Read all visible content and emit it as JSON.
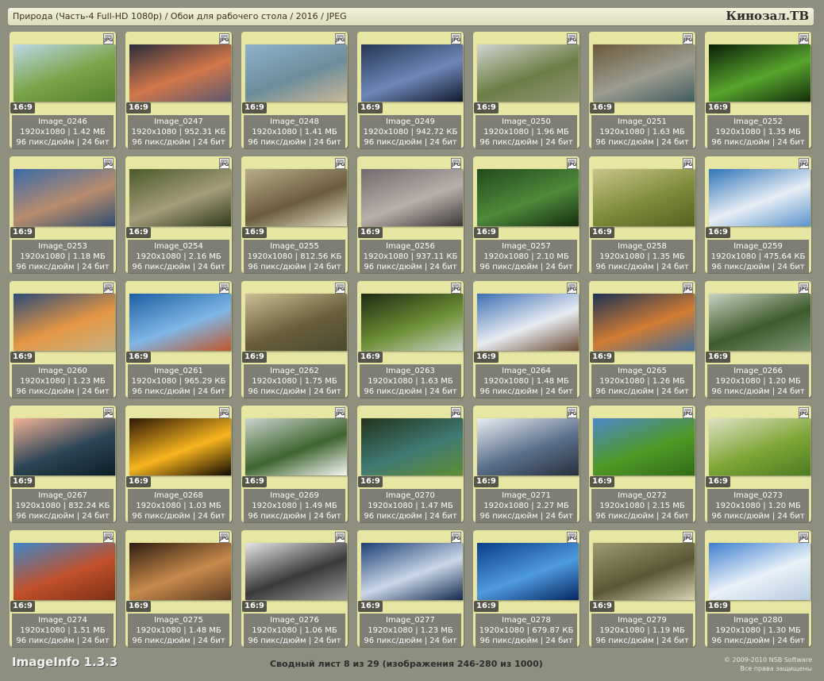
{
  "header": {
    "title": "Природа (Часть-4 Full-HD 1080p) / Обои для рабочего стола / 2016 / JPEG",
    "brand": "Кинозал.ТВ"
  },
  "tile_labels": {
    "format_badge": "JPG",
    "aspect": "16:9"
  },
  "images": [
    {
      "name": "Image_0246",
      "dims": "1920x1080 | 1.42 МБ",
      "meta": "96 пикс/дюйм | 24 бит",
      "colors": [
        "#bcd7e6",
        "#7aa346",
        "#56802e"
      ]
    },
    {
      "name": "Image_0247",
      "dims": "1920x1080 | 952.31 КБ",
      "meta": "96 пикс/дюйм | 24 бит",
      "colors": [
        "#2b2c3b",
        "#d2774a",
        "#5c5870"
      ]
    },
    {
      "name": "Image_0248",
      "dims": "1920x1080 | 1.41 МБ",
      "meta": "96 пикс/дюйм | 24 бит",
      "colors": [
        "#8fb2cc",
        "#6d8d9b",
        "#c9b89a"
      ]
    },
    {
      "name": "Image_0249",
      "dims": "1920x1080 | 942.72 КБ",
      "meta": "96 пикс/дюйм | 24 бит",
      "colors": [
        "#233654",
        "#6f87b8",
        "#101a2e"
      ]
    },
    {
      "name": "Image_0250",
      "dims": "1920x1080 | 1.96 МБ",
      "meta": "96 пикс/дюйм | 24 бит",
      "colors": [
        "#d0d4cf",
        "#6d7e45",
        "#8e9473"
      ]
    },
    {
      "name": "Image_0251",
      "dims": "1920x1080 | 1.63 МБ",
      "meta": "96 пикс/дюйм | 24 бит",
      "colors": [
        "#6b5a3c",
        "#9c9c8f",
        "#415c60"
      ]
    },
    {
      "name": "Image_0252",
      "dims": "1920x1080 | 1.35 МБ",
      "meta": "96 пикс/дюйм | 24 бит",
      "colors": [
        "#0c1e08",
        "#56a52d",
        "#142d0b"
      ]
    },
    {
      "name": "Image_0253",
      "dims": "1920x1080 | 1.18 МБ",
      "meta": "96 пикс/дюйм | 24 бит",
      "colors": [
        "#3a6aa8",
        "#b98c6d",
        "#2e4d70"
      ]
    },
    {
      "name": "Image_0254",
      "dims": "1920x1080 | 2.16 МБ",
      "meta": "96 пикс/дюйм | 24 бит",
      "colors": [
        "#4b5a2a",
        "#a59c7a",
        "#2f3a1c"
      ]
    },
    {
      "name": "Image_0255",
      "dims": "1920x1080 | 812.56 КБ",
      "meta": "96 пикс/дюйм | 24 бит",
      "colors": [
        "#b8ad8a",
        "#6b5c3e",
        "#e3dcc2"
      ]
    },
    {
      "name": "Image_0256",
      "dims": "1920x1080 | 937.11 КБ",
      "meta": "96 пикс/дюйм | 24 бит",
      "colors": [
        "#716a6c",
        "#b9b0aa",
        "#3c3838"
      ]
    },
    {
      "name": "Image_0257",
      "dims": "1920x1080 | 2.10 МБ",
      "meta": "96 пикс/дюйм | 24 бит",
      "colors": [
        "#234a1d",
        "#4e8a3a",
        "#152e10"
      ]
    },
    {
      "name": "Image_0258",
      "dims": "1920x1080 | 1.35 МБ",
      "meta": "96 пикс/дюйм | 24 бит",
      "colors": [
        "#c9c48a",
        "#7e8b3a",
        "#556122"
      ]
    },
    {
      "name": "Image_0259",
      "dims": "1920x1080 | 475.64 КБ",
      "meta": "96 пикс/дюйм | 24 бит",
      "colors": [
        "#2f74b8",
        "#e8eef5",
        "#5a94cc"
      ]
    },
    {
      "name": "Image_0260",
      "dims": "1920x1080 | 1.23 МБ",
      "meta": "96 пикс/дюйм | 24 бит",
      "colors": [
        "#2c4a78",
        "#e49643",
        "#c7b284"
      ]
    },
    {
      "name": "Image_0261",
      "dims": "1920x1080 | 965.29 КБ",
      "meta": "96 пикс/дюйм | 24 бит",
      "colors": [
        "#1d5ea4",
        "#7fb6e6",
        "#c0562a"
      ]
    },
    {
      "name": "Image_0262",
      "dims": "1920x1080 | 1.75 МБ",
      "meta": "96 пикс/дюйм | 24 бит",
      "colors": [
        "#cbbf94",
        "#6a5e3c",
        "#4a4a30"
      ]
    },
    {
      "name": "Image_0263",
      "dims": "1920x1080 | 1.63 МБ",
      "meta": "96 пикс/дюйм | 24 бит",
      "colors": [
        "#1d2b14",
        "#6c8f34",
        "#c6d4c8"
      ]
    },
    {
      "name": "Image_0264",
      "dims": "1920x1080 | 1.48 МБ",
      "meta": "96 пикс/дюйм | 24 бит",
      "colors": [
        "#3c6fb3",
        "#e8ecf2",
        "#6b4a33"
      ]
    },
    {
      "name": "Image_0265",
      "dims": "1920x1080 | 1.26 МБ",
      "meta": "96 пикс/дюйм | 24 бит",
      "colors": [
        "#1c3155",
        "#d27c33",
        "#3e6e9e"
      ]
    },
    {
      "name": "Image_0266",
      "dims": "1920x1080 | 1.20 МБ",
      "meta": "96 пикс/дюйм | 24 бит",
      "colors": [
        "#c8d2c2",
        "#3d5a2c",
        "#7f9677"
      ]
    },
    {
      "name": "Image_0267",
      "dims": "1920x1080 | 832.24 КБ",
      "meta": "96 пикс/дюйм | 24 бит",
      "colors": [
        "#f3b399",
        "#2c4555",
        "#0e1d28"
      ]
    },
    {
      "name": "Image_0268",
      "dims": "1920x1080 | 1.03 МБ",
      "meta": "96 пикс/дюйм | 24 бит",
      "colors": [
        "#2d1806",
        "#f7b51e",
        "#120a03"
      ]
    },
    {
      "name": "Image_0269",
      "dims": "1920x1080 | 1.49 МБ",
      "meta": "96 пикс/дюйм | 24 бит",
      "colors": [
        "#c9d4cd",
        "#3f6530",
        "#f4f7f4"
      ]
    },
    {
      "name": "Image_0270",
      "dims": "1920x1080 | 1.47 МБ",
      "meta": "96 пикс/дюйм | 24 бит",
      "colors": [
        "#23331b",
        "#3f7a74",
        "#5e8e33"
      ]
    },
    {
      "name": "Image_0271",
      "dims": "1920x1080 | 2.27 МБ",
      "meta": "96 пикс/дюйм | 24 бит",
      "colors": [
        "#e8edf2",
        "#5a6f8a",
        "#27303d"
      ]
    },
    {
      "name": "Image_0272",
      "dims": "1920x1080 | 2.15 МБ",
      "meta": "96 пикс/дюйм | 24 бит",
      "colors": [
        "#4d86c9",
        "#4f9a26",
        "#2f6c16"
      ]
    },
    {
      "name": "Image_0273",
      "dims": "1920x1080 | 1.20 МБ",
      "meta": "96 пикс/дюйм | 24 бит",
      "colors": [
        "#dfe2c4",
        "#7ea637",
        "#4d7a1f"
      ]
    },
    {
      "name": "Image_0274",
      "dims": "1920x1080 | 1.51 МБ",
      "meta": "96 пикс/дюйм | 24 бит",
      "colors": [
        "#3f87c8",
        "#c2502a",
        "#7a2f18"
      ]
    },
    {
      "name": "Image_0275",
      "dims": "1920x1080 | 1.48 МБ",
      "meta": "96 пикс/дюйм | 24 бит",
      "colors": [
        "#2e1d10",
        "#c88a4b",
        "#5b3a22"
      ]
    },
    {
      "name": "Image_0276",
      "dims": "1920x1080 | 1.06 МБ",
      "meta": "96 пикс/дюйм | 24 бит",
      "colors": [
        "#e5e5e5",
        "#3a3a3a",
        "#9a9a9a"
      ]
    },
    {
      "name": "Image_0277",
      "dims": "1920x1080 | 1.23 МБ",
      "meta": "96 пикс/дюйм | 24 бит",
      "colors": [
        "#1e3f74",
        "#c9d7e8",
        "#12294f"
      ]
    },
    {
      "name": "Image_0278",
      "dims": "1920x1080 | 679.87 КБ",
      "meta": "96 пикс/дюйм | 24 бит",
      "colors": [
        "#0a3d8a",
        "#4e9be0",
        "#062560"
      ]
    },
    {
      "name": "Image_0279",
      "dims": "1920x1080 | 1.19 МБ",
      "meta": "96 пикс/дюйм | 24 бит",
      "colors": [
        "#9e9a72",
        "#5b5735",
        "#d6d2b4"
      ]
    },
    {
      "name": "Image_0280",
      "dims": "1920x1080 | 1.30 МБ",
      "meta": "96 пикс/дюйм | 24 бит",
      "colors": [
        "#3f7fd0",
        "#e9f1f8",
        "#b8cce0"
      ]
    }
  ],
  "footer": {
    "app_name": "ImageInfo 1.3.3",
    "summary": "Сводный лист 8 из 29 (изображения 246-280 из 1000)",
    "copyright": "© 2009-2010 NSB Software",
    "rights": "Все права защищены"
  },
  "colors": {
    "page_bg": "#8f8f80",
    "tile_bg": "#e7e6a3",
    "info_bg": "#7e7e74"
  }
}
